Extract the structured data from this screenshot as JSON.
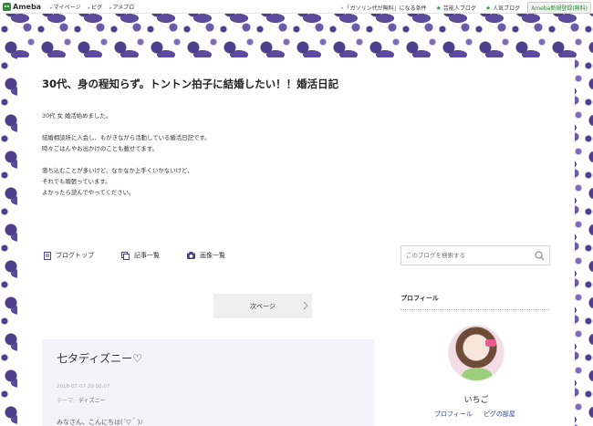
{
  "topbar": {
    "logo": "Ameba",
    "nav": [
      "マイページ",
      "ピグ",
      "アメブロ"
    ],
    "promo": "「ガソリン代が無料」になる条件",
    "official_blog": "芸能人ブログ",
    "popular_blog": "人気ブログ",
    "register": "Ameba新規登録(無料)"
  },
  "blog": {
    "title": "30代、身の程知らず。トントン拍子に結婚したい！！婚活日記",
    "description": [
      "30代 女 婚活始めました。",
      "",
      "結婚相談所に入会し、もがきながら活動している婚活日記です。",
      "時々ごはんやお出かけのことも載せてます。",
      "",
      "落ち込むことが多いけど、なかなか上手くいかないけど、",
      "それでも頑張っています。",
      "よかったら読んでやってください。"
    ]
  },
  "blog_nav": {
    "top": "ブログトップ",
    "articles": "記事一覧",
    "images": "画像一覧"
  },
  "search": {
    "placeholder": "このブログを検索する"
  },
  "pager": {
    "next": "次ページ"
  },
  "entry": {
    "title": "七タディズニー♡",
    "date": "2018-07-07 20:00:07",
    "theme_label": "テーマ:",
    "theme": "ディズニー",
    "body": "みなさん、こんにちは(´▽｀)ﾉ"
  },
  "profile": {
    "heading": "プロフィール",
    "name": "いちご",
    "links": [
      "プロフィール",
      "ピグの部屋"
    ]
  },
  "colors": {
    "accent_purple": "#4e3f8c",
    "ameba_green": "#2d8c3c",
    "link_blue": "#334c9f"
  }
}
